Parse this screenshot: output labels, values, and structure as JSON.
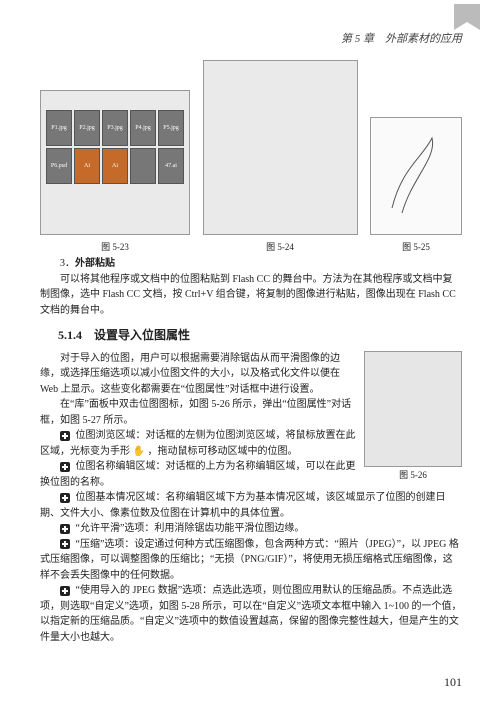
{
  "header": {
    "chapter": "第 5 章",
    "title": "外部素材的应用"
  },
  "page": {
    "number": "101"
  },
  "figures": {
    "row": [
      {
        "caption": "图 5-23"
      },
      {
        "caption": "图 5-24"
      },
      {
        "caption": "图 5-25"
      }
    ],
    "float": {
      "caption": "图 5-26"
    }
  },
  "grid_labels": [
    "P1.jpg",
    "P2.jpg",
    "P3.jpg",
    "P4.jpg",
    "P5.jpg",
    "P6.psd",
    "Ai",
    "Ai",
    "",
    "47.ai"
  ],
  "section": {
    "item3_num": "3．",
    "item3": "外部粘贴",
    "para3": "可以将其他程序或文档中的位图粘贴到 Flash CC 的舞台中。方法为在其他程序或文档中复制图像，选中 Flash CC 文档，按 Ctrl+V 组合键，将复制的图像进行粘贴，图像出现在 Flash CC 文档的舞台中。",
    "h4": "5.1.4　设置导入位图属性",
    "p1": "对于导入的位图，用户可以根据需要消除锯齿从而平滑图像的边缘，或选择压缩选项以减小位图文件的大小，以及格式化文件以便在 Web 上显示。这些变化都需要在“位图属性”对话框中进行设置。",
    "p2": "在“库”面板中双击位图图标，如图 5-26 所示，弹出“位图属性”对话框，如图 5-27 所示。",
    "b1": "位图浏览区域：对话框的左侧为位图浏览区域，将鼠标放置在此区域，光标变为手形",
    "b1tail": "，拖动鼠标可移动区域中的位图。",
    "b2": "位图名称编辑区域：对话框的上方为名称编辑区域，可以在此更换位图的名称。",
    "b3": "位图基本情况区域：名称编辑区域下方为基本情况区域，该区域显示了位图的创建日期、文件大小、像素位数及位图在计算机中的具体位置。",
    "b4": "“允许平滑”选项：利用消除锯齿功能平滑位图边缘。",
    "b5": "“压缩”选项：设定通过何种方式压缩图像，包含两种方式：“照片（JPEG）”，以 JPEG 格式压缩图像，可以调整图像的压缩比；“无损（PNG/GIF）”，将使用无损压缩格式压缩图像，这样不会丢失图像中的任何数据。",
    "b6": "“使用导入的 JPEG 数据”选项：点选此选项，则位图应用默认的压缩品质。不点选此选项，则选取“自定义”选项，如图 5-28 所示，可以在“自定义”选项文本框中输入 1~100 的一个值，以指定新的压缩品质。“自定义”选项中的数值设置越高，保留的图像完整性越大，但是产生的文件量大小也越大。"
  }
}
